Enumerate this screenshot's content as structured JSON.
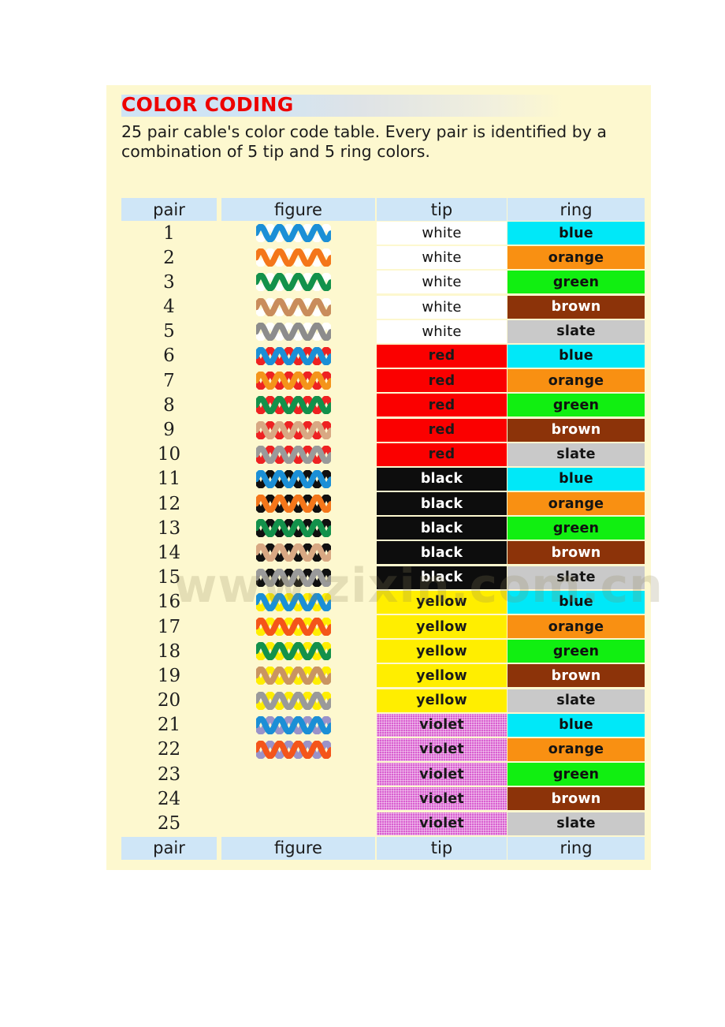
{
  "document": {
    "title": "COLOR CODING",
    "subtitle": "25 pair cable's color code table. Every pair is identified by a combination of 5 tip and 5 ring colors.",
    "watermark": "www.zixin.com.cn",
    "title_color": "#ee0000",
    "panel_background": "#fdf8cf",
    "header_background": "#cfe6f7"
  },
  "table": {
    "columns": [
      {
        "key": "pair",
        "label": "pair"
      },
      {
        "key": "figure",
        "label": "figure"
      },
      {
        "key": "tip",
        "label": "tip"
      },
      {
        "key": "ring",
        "label": "ring"
      }
    ],
    "color_swatches": {
      "white": "#ffffff",
      "red": "#fb0000",
      "black": "#0d0d0d",
      "yellow": "#ffee00",
      "violet": "#d95fd0",
      "blue": "#00e8f8",
      "orange": "#f99012",
      "green": "#11ef11",
      "brown": "#8c3309",
      "slate": "#c9c9c9"
    },
    "rows": [
      {
        "pair": "1",
        "tip": "white",
        "ring": "blue",
        "figure": true,
        "fig_a": "#ffffff",
        "fig_b": "#1b8fd6"
      },
      {
        "pair": "2",
        "tip": "white",
        "ring": "orange",
        "figure": true,
        "fig_a": "#ffffff",
        "fig_b": "#f4761a"
      },
      {
        "pair": "3",
        "tip": "white",
        "ring": "green",
        "figure": true,
        "fig_a": "#ffffff",
        "fig_b": "#13914b"
      },
      {
        "pair": "4",
        "tip": "white",
        "ring": "brown",
        "figure": true,
        "fig_a": "#ffffff",
        "fig_b": "#c98c5c"
      },
      {
        "pair": "5",
        "tip": "white",
        "ring": "slate",
        "figure": true,
        "fig_a": "#ffffff",
        "fig_b": "#8c8c8c"
      },
      {
        "pair": "6",
        "tip": "red",
        "ring": "blue",
        "figure": true,
        "fig_a": "#ee2222",
        "fig_b": "#1b8fd6"
      },
      {
        "pair": "7",
        "tip": "red",
        "ring": "orange",
        "figure": true,
        "fig_a": "#ee2222",
        "fig_b": "#f4941a"
      },
      {
        "pair": "8",
        "tip": "red",
        "ring": "green",
        "figure": true,
        "fig_a": "#ee2222",
        "fig_b": "#13914b"
      },
      {
        "pair": "9",
        "tip": "red",
        "ring": "brown",
        "figure": true,
        "fig_a": "#ee2222",
        "fig_b": "#d8a883"
      },
      {
        "pair": "10",
        "tip": "red",
        "ring": "slate",
        "figure": true,
        "fig_a": "#ee2222",
        "fig_b": "#9a9a9a"
      },
      {
        "pair": "11",
        "tip": "black",
        "ring": "blue",
        "figure": true,
        "fig_a": "#101010",
        "fig_b": "#1b8fd6"
      },
      {
        "pair": "12",
        "tip": "black",
        "ring": "orange",
        "figure": true,
        "fig_a": "#101010",
        "fig_b": "#f4761a"
      },
      {
        "pair": "13",
        "tip": "black",
        "ring": "green",
        "figure": true,
        "fig_a": "#101010",
        "fig_b": "#13914b"
      },
      {
        "pair": "14",
        "tip": "black",
        "ring": "brown",
        "figure": true,
        "fig_a": "#101010",
        "fig_b": "#d8a883"
      },
      {
        "pair": "15",
        "tip": "black",
        "ring": "slate",
        "figure": true,
        "fig_a": "#101010",
        "fig_b": "#9a9a9a"
      },
      {
        "pair": "16",
        "tip": "yellow",
        "ring": "blue",
        "figure": true,
        "fig_a": "#ffee00",
        "fig_b": "#1b8fd6"
      },
      {
        "pair": "17",
        "tip": "yellow",
        "ring": "orange",
        "figure": true,
        "fig_a": "#ffee00",
        "fig_b": "#f4551a"
      },
      {
        "pair": "18",
        "tip": "yellow",
        "ring": "green",
        "figure": true,
        "fig_a": "#ffee00",
        "fig_b": "#13914b"
      },
      {
        "pair": "19",
        "tip": "yellow",
        "ring": "brown",
        "figure": true,
        "fig_a": "#ffee00",
        "fig_b": "#c99462"
      },
      {
        "pair": "20",
        "tip": "yellow",
        "ring": "slate",
        "figure": true,
        "fig_a": "#ffee00",
        "fig_b": "#9a9a9a"
      },
      {
        "pair": "21",
        "tip": "violet",
        "ring": "blue",
        "figure": true,
        "fig_a": "#9a93c9",
        "fig_b": "#1b8fd6"
      },
      {
        "pair": "22",
        "tip": "violet",
        "ring": "orange",
        "figure": true,
        "fig_a": "#9a93c9",
        "fig_b": "#f4551a"
      },
      {
        "pair": "23",
        "tip": "violet",
        "ring": "green",
        "figure": false,
        "fig_a": "",
        "fig_b": ""
      },
      {
        "pair": "24",
        "tip": "violet",
        "ring": "brown",
        "figure": false,
        "fig_a": "",
        "fig_b": ""
      },
      {
        "pair": "25",
        "tip": "violet",
        "ring": "slate",
        "figure": false,
        "fig_a": "",
        "fig_b": ""
      }
    ]
  }
}
